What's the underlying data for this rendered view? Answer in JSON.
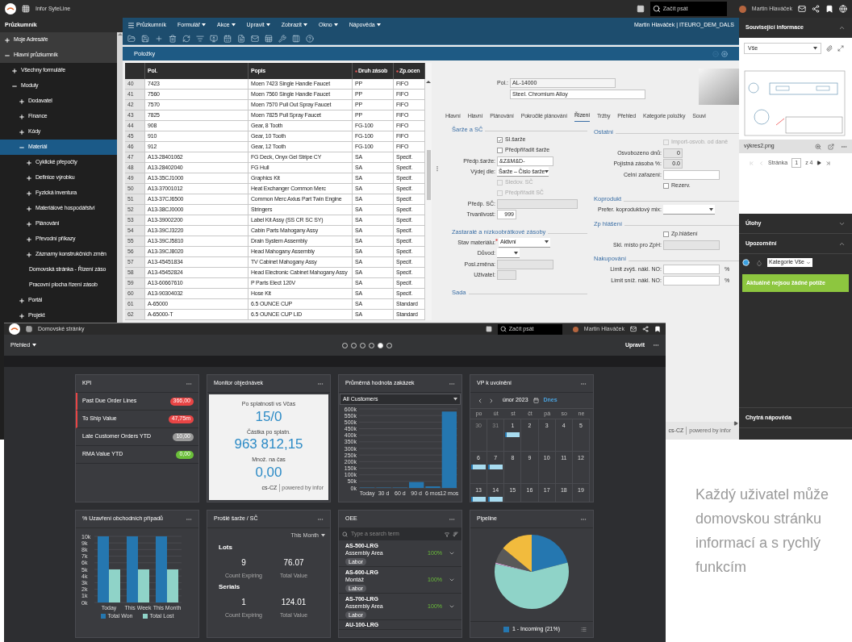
{
  "top_window": {
    "top_bar": {
      "title": "Infor SyteLine",
      "search": {
        "placeholder": "Začít psát"
      },
      "user": "Martin Hlaváček"
    },
    "sidebar": {
      "title": "Průzkumník",
      "items": [
        {
          "label": "Moje Adresáře",
          "expanded": false,
          "selected": false
        },
        {
          "label": "Hlavní průzkumník",
          "expanded": true,
          "selected": false,
          "children": [
            {
              "label": "Všechny formuláře",
              "expanded": false,
              "selected": false
            },
            {
              "label": "Moduly",
              "expanded": true,
              "selected": false,
              "children": [
                {
                  "label": "Dodavatel",
                  "expanded": false,
                  "selected": false
                },
                {
                  "label": "Finance",
                  "expanded": false,
                  "selected": false
                },
                {
                  "label": "Kódy",
                  "expanded": false,
                  "selected": false
                },
                {
                  "label": "Materiál",
                  "expanded": true,
                  "selected": true,
                  "children": [
                    {
                      "label": "Cyklické přepočty",
                      "expanded": false,
                      "selected": false
                    },
                    {
                      "label": "Definice výrobku",
                      "expanded": false,
                      "selected": false
                    },
                    {
                      "label": "Fyzická inventura",
                      "expanded": false,
                      "selected": false
                    },
                    {
                      "label": "Materiálové hospodářství",
                      "expanded": false,
                      "selected": false
                    },
                    {
                      "label": "Plánování",
                      "expanded": false,
                      "selected": false
                    },
                    {
                      "label": "Převodní příkazy",
                      "expanded": false,
                      "selected": false
                    },
                    {
                      "label": "Záznamy konstrukčních změn",
                      "expanded": false,
                      "selected": false
                    },
                    {
                      "label": "Domovská stránka - Řízení záso",
                      "selected": false
                    },
                    {
                      "label": "Pracovní plocha řízení zásob",
                      "selected": false
                    }
                  ]
                },
                {
                  "label": "Portál",
                  "expanded": false,
                  "selected": false
                },
                {
                  "label": "Projekt",
                  "expanded": false,
                  "selected": false
                }
              ]
            }
          ]
        }
      ]
    },
    "menu": {
      "items": [
        {
          "label": "Průzkumník",
          "kind": "explorer"
        },
        {
          "label": "Formulář",
          "kind": "menu"
        },
        {
          "label": "Akce",
          "kind": "menu"
        },
        {
          "label": "Upravit",
          "kind": "menu"
        },
        {
          "label": "Zobrazit",
          "kind": "menu"
        },
        {
          "label": "Okno",
          "kind": "menu"
        },
        {
          "label": "Nápověda",
          "kind": "menu"
        }
      ],
      "user_info": "Martin Hlaváček | ITEURO_DEM_DALS"
    },
    "form_title": "Položky",
    "table": {
      "columns": [
        {
          "required": false
        },
        {
          "label": "Pol.",
          "required": false
        },
        {
          "label": "Popis",
          "required": false
        },
        {
          "label": "Druh zásob",
          "required": true
        },
        {
          "label": "Zp.ocen",
          "required": true
        }
      ],
      "rows": [
        [
          "40",
          "7423",
          "Moen 7423 Single Handle Faucet",
          "PP",
          "FIFO"
        ],
        [
          "41",
          "7560",
          "Moen 7560 Single Handle Faucet",
          "PP",
          "FIFO"
        ],
        [
          "42",
          "7570",
          "Moen 7570 Pull Out Spray Faucet",
          "PP",
          "FIFO"
        ],
        [
          "43",
          "7825",
          "Moen 7825 Pull Spray Faucet",
          "PP",
          "FIFO"
        ],
        [
          "44",
          "908",
          "Gear, 8 Tooth",
          "FG-100",
          "FIFO"
        ],
        [
          "45",
          "910",
          "Gear, 10 Tooth",
          "FG-100",
          "FIFO"
        ],
        [
          "46",
          "912",
          "Gear, 12 Tooth",
          "FG-100",
          "FIFO"
        ],
        [
          "47",
          "A13-28401062",
          "FG Deck, Onyx Gel Stripe CY",
          "SA",
          "Specif."
        ],
        [
          "48",
          "A13-28402040",
          "FG Hull",
          "SA",
          "Specif."
        ],
        [
          "49",
          "A13-35CJ1000",
          "Graphics Kit",
          "SA",
          "Specif."
        ],
        [
          "50",
          "A13-37001012",
          "Heat Exchanger Common Merc",
          "SA",
          "Specif."
        ],
        [
          "51",
          "A13-37CJ6500",
          "Common Merc Axius Part Twin Engine",
          "SA",
          "Specif."
        ],
        [
          "52",
          "A13-38CJ0000",
          "Stringers",
          "SA",
          "Specif."
        ],
        [
          "53",
          "A13-39002200",
          "Label Kit Assy (SS CR SC SY)",
          "SA",
          "Specif."
        ],
        [
          "54",
          "A13-39CJ3220",
          "Cabin Parts Mahogany Assy",
          "SA",
          "Specif."
        ],
        [
          "55",
          "A13-39CJ5810",
          "Drain System Assembly",
          "SA",
          "Specif."
        ],
        [
          "56",
          "A13-39CJ8020",
          "Head Mahogany Assembly",
          "SA",
          "Specif."
        ],
        [
          "57",
          "A13-45451834",
          "TV Cabinet Mahogany Assy",
          "SA",
          "Specif."
        ],
        [
          "58",
          "A13-45452824",
          "Head Electronic Cabinet Mahogany Assy",
          "SA",
          "Specif."
        ],
        [
          "59",
          "A13-60667610",
          "P Parts Elect 120V",
          "SA",
          "Specif."
        ],
        [
          "60",
          "A13-90304032",
          "Hose Kit",
          "SA",
          "Specif."
        ],
        [
          "61",
          "A-65000",
          "6.5 OUNCE CUP",
          "SA",
          "Standard"
        ],
        [
          "62",
          "A-65000-T",
          "6.5 OUNCE CUP LID",
          "SA",
          "Standard"
        ]
      ]
    },
    "item": {
      "label": "Pol.:",
      "code": "AL-14000",
      "description": "Steel. Chromium Alloy"
    },
    "tabs": [
      {
        "label": "Hlavní",
        "selected": false
      },
      {
        "label": "Hlavní",
        "selected": false
      },
      {
        "label": "Plánování",
        "selected": false
      },
      {
        "label": "Pokročilé plánování",
        "selected": false
      },
      {
        "label": "Řízení",
        "selected": true
      },
      {
        "label": "Tržby",
        "selected": false
      },
      {
        "label": "Přehled",
        "selected": false
      },
      {
        "label": "Kategorie položky",
        "selected": false
      },
      {
        "label": "Souvi",
        "selected": false
      }
    ],
    "left_sections": [
      {
        "title": "Šarže a SČ",
        "fields": [
          {
            "kind": "checkbox",
            "label": "Sl.šarže",
            "checked": true,
            "disabled": false
          },
          {
            "kind": "checkbox",
            "label": "Předpřiřadit šarže",
            "checked": false,
            "disabled": false
          },
          {
            "kind": "text",
            "label": "Předp.šarže:",
            "value": "&Z&M&D-",
            "disabled": false
          },
          {
            "kind": "select",
            "label": "Výdej dle:",
            "value": "Šarže – Číslo šarže",
            "disabled": false
          },
          {
            "kind": "checkbox",
            "label": "Sledov. SČ",
            "checked": false,
            "disabled": true
          },
          {
            "kind": "checkbox",
            "label": "Předpřiřadit SČ",
            "checked": false,
            "disabled": true
          },
          {
            "kind": "wide_text",
            "label": "Předp. SČ:",
            "disabled": true
          },
          {
            "kind": "number",
            "label": "Trvanlivost:",
            "value": "999",
            "disabled": false
          }
        ]
      },
      {
        "title": "Zastaralé a nízkoobrátkové zásoby",
        "fields": [
          {
            "kind": "select",
            "label": "Stav materiálu:",
            "value": "Aktivní",
            "required": true,
            "disabled": false
          },
          {
            "kind": "short_select",
            "label": "Důvod:",
            "disabled": false
          },
          {
            "kind": "text",
            "label": "Posl.změna:",
            "disabled": true
          },
          {
            "kind": "number",
            "label": "Uživatel:",
            "disabled": true
          }
        ]
      },
      {
        "title": "Sada"
      }
    ],
    "right_sections": [
      {
        "title": "Ostatní",
        "fields": [
          {
            "kind": "checkbox",
            "label": "Import-osvob. od daně",
            "checked": false,
            "disabled": true
          },
          {
            "kind": "number",
            "label": "Osvobozeno dnů:",
            "value": "0",
            "disabled": true
          },
          {
            "kind": "number",
            "label": "Pojistná zásoba %:",
            "value": "0.0",
            "disabled": true
          },
          {
            "kind": "wide_text",
            "label": "Celní zařazení:",
            "disabled": false
          },
          {
            "kind": "checkbox",
            "label": "Rezerv.",
            "checked": false,
            "disabled": false
          }
        ]
      },
      {
        "title": "Koprodukt",
        "fields": [
          {
            "kind": "select",
            "label": "Prefer. koproduktový mix:",
            "disabled": false
          }
        ]
      },
      {
        "title": "Zp hlášení",
        "fields": [
          {
            "kind": "checkbox",
            "label": "Zp.hlášení",
            "checked": false,
            "disabled": false
          },
          {
            "kind": "wide_text",
            "label": "Skl. místo pro ZpH:",
            "disabled": true
          }
        ]
      },
      {
        "title": "Nakupování",
        "fields": [
          {
            "kind": "wide_text",
            "label": "Limit zvýš. nákl. NO:",
            "suffix": "%",
            "disabled": false
          },
          {
            "kind": "wide_text",
            "label": "Limit sníž. nákl. NO:",
            "suffix": "%",
            "disabled": false
          }
        ]
      }
    ],
    "footer": {
      "locale": "cs-CZ",
      "powered_by": "powered by infor"
    },
    "panels": [
      {
        "kind": "related",
        "title": "Související informace",
        "expanded": true,
        "filter": "Vše",
        "file_name": "výkres2.png",
        "pager": {
          "label": "Stránka",
          "page": "1",
          "total": "z 4"
        }
      },
      {
        "kind": "tasks",
        "title": "Úlohy",
        "expanded": false
      },
      {
        "kind": "alerts",
        "title": "Upozornění",
        "expanded": true,
        "category": "Kategorie Vše",
        "message": "Aktuálně nejsou žádné potíže"
      },
      {
        "kind": "help",
        "title": "Chytrá nápověda"
      }
    ]
  },
  "bottom_window": {
    "top_bar": {
      "title": "Domovské stránky",
      "search": {
        "placeholder": "Začít psát"
      },
      "user": "Martin Hlaváček"
    },
    "page_selector": "Přehled",
    "pages": [
      {
        "selected": false
      },
      {
        "selected": false
      },
      {
        "selected": false
      },
      {
        "selected": false
      },
      {
        "selected": true
      },
      {
        "selected": false
      }
    ],
    "edit_button": "Upravit",
    "cards": [
      {
        "kind": "kpi",
        "title": "KPI",
        "items": [
          {
            "label": "Past Due Order Lines",
            "value": "366,00",
            "color": "#e84545",
            "flagged": true
          },
          {
            "label": "To Ship Value",
            "value": "47,75m",
            "color": "#e84545",
            "flagged": true
          },
          {
            "label": "Late Customer Orders YTD",
            "value": "10,00",
            "color": "#9a9a9a",
            "flagged": false
          },
          {
            "label": "RMA Value YTD",
            "value": "0,00",
            "color": "#6bbf3a",
            "flagged": false
          }
        ]
      },
      {
        "kind": "monitor",
        "title": "Monitor objednávek",
        "metrics": [
          {
            "label": "Po splatnosti vs Včas",
            "value": "15/0"
          },
          {
            "label": "Částka po splatn.",
            "value": "963 812,15"
          },
          {
            "label": "Množ. na čas",
            "value": "0,00"
          }
        ],
        "locale": "cs-CZ",
        "powered_by": "powered by infor"
      },
      {
        "kind": "bar_chart",
        "title": "Průměrná hodnota zakázek",
        "filter": "All Customers",
        "chart_data": {
          "type": "bar",
          "categories": [
            "Today",
            "30 d",
            "60 d",
            "90 d",
            "6 mos",
            "12 mos"
          ],
          "values": [
            3000,
            3000,
            3000,
            45000,
            12000,
            580000
          ],
          "ylim": [
            0,
            600000
          ],
          "grid": true,
          "yticks": [
            {
              "value": 0,
              "label": "0k"
            },
            {
              "value": 50000,
              "label": "50k"
            },
            {
              "value": 100000,
              "label": "100k"
            },
            {
              "value": 150000,
              "label": "150k"
            },
            {
              "value": 200000,
              "label": "200k"
            },
            {
              "value": 250000,
              "label": "250k"
            },
            {
              "value": 300000,
              "label": "300k"
            },
            {
              "value": 350000,
              "label": "350k"
            },
            {
              "value": 400000,
              "label": "400k"
            },
            {
              "value": 450000,
              "label": "450k"
            },
            {
              "value": 500000,
              "label": "500k"
            },
            {
              "value": 550000,
              "label": "550k"
            },
            {
              "value": 600000,
              "label": "600k"
            }
          ]
        }
      },
      {
        "kind": "calendar",
        "title": "VP k uvolnění",
        "month": "únor 2023",
        "today": "Dnes",
        "weekdays": [
          "po",
          "út",
          "st",
          "čt",
          "pá",
          "so",
          "ne"
        ],
        "weeks": [
          [
            {
              "day": "30",
              "muted": true,
              "event": false
            },
            {
              "day": "31",
              "muted": true,
              "event": false
            },
            {
              "day": "1",
              "muted": false,
              "event": true
            },
            {
              "day": "2",
              "muted": false,
              "event": false
            },
            {
              "day": "3",
              "muted": false,
              "event": false
            },
            {
              "day": "4",
              "muted": false,
              "event": false
            },
            {
              "day": "5",
              "muted": false,
              "event": false
            }
          ],
          [
            {
              "day": "6",
              "muted": false,
              "event": true
            },
            {
              "day": "7",
              "muted": false,
              "event": true
            },
            {
              "day": "8",
              "muted": false,
              "event": false
            },
            {
              "day": "9",
              "muted": false,
              "event": false
            },
            {
              "day": "10",
              "muted": false,
              "event": false
            },
            {
              "day": "11",
              "muted": false,
              "event": false
            },
            {
              "day": "12",
              "muted": false,
              "event": false
            }
          ],
          [
            {
              "day": "13",
              "muted": false,
              "event": true
            },
            {
              "day": "14",
              "muted": false,
              "event": true
            },
            {
              "day": "15",
              "muted": false,
              "event": false
            },
            {
              "day": "16",
              "muted": false,
              "event": false
            },
            {
              "day": "17",
              "muted": false,
              "event": false
            },
            {
              "day": "18",
              "muted": false,
              "event": false
            },
            {
              "day": "19",
              "muted": false,
              "event": false
            }
          ]
        ]
      },
      {
        "kind": "grouped_chart",
        "title": "% Uzavření obchodních případů",
        "chart_data": {
          "type": "bar",
          "categories": [
            "Today",
            "This Week",
            "This Month"
          ],
          "series": [
            {
              "name": "Total Won",
              "color": "#2577b0",
              "values": [
                10000,
                10000,
                10000
              ]
            },
            {
              "name": "Total Lost",
              "color": "#8fd3c8",
              "values": [
                5000,
                5000,
                5000
              ]
            }
          ],
          "ylim": [
            0,
            10000
          ],
          "grid": true,
          "legend": "bottom",
          "yticks": [
            {
              "value": 0,
              "label": "0k"
            },
            {
              "value": 1000,
              "label": "1k"
            },
            {
              "value": 2000,
              "label": "2k"
            },
            {
              "value": 3000,
              "label": "3k"
            },
            {
              "value": 4000,
              "label": "4k"
            },
            {
              "value": 5000,
              "label": "5k"
            },
            {
              "value": 6000,
              "label": "6k"
            },
            {
              "value": 7000,
              "label": "7k"
            },
            {
              "value": 8000,
              "label": "8k"
            },
            {
              "value": 9000,
              "label": "9k"
            },
            {
              "value": 10000,
              "label": "10k"
            }
          ]
        }
      },
      {
        "kind": "expiring",
        "title": "Prošlé šarže / SČ",
        "period": "This Month",
        "groups": [
          {
            "title": "Lots",
            "stats": [
              {
                "value": "9",
                "label": "Count Expiring"
              },
              {
                "value": "76.07",
                "label": "Total Value"
              }
            ]
          },
          {
            "title": "Serials",
            "stats": [
              {
                "value": "1",
                "label": "Count Expiring"
              },
              {
                "value": "124.01",
                "label": "Total Value"
              }
            ]
          }
        ]
      },
      {
        "kind": "oee",
        "title": "OEE",
        "search": {
          "placeholder": "Type a search term"
        },
        "items": [
          {
            "code": "AS-500-LRG",
            "area": "Assembly Area",
            "value": "100%",
            "tag": "Labor"
          },
          {
            "code": "AS-600-LRG",
            "area": "Montáž",
            "value": "100%",
            "tag": "Labor"
          },
          {
            "code": "AS-700-LRG",
            "area": "Assembly Area",
            "value": "100%",
            "tag": "Labor"
          },
          {
            "code": "AU-100-LRG"
          }
        ]
      },
      {
        "kind": "pie",
        "title": "Pipeline",
        "legend": {
          "label": "1 - Incoming (21%)",
          "color": "#2577b0"
        }
      }
    ]
  },
  "promo_text": {
    "lines": [
      "Každý uživatel může",
      "domovskou stránku",
      "informací a s rychlý",
      "funkcím"
    ]
  }
}
